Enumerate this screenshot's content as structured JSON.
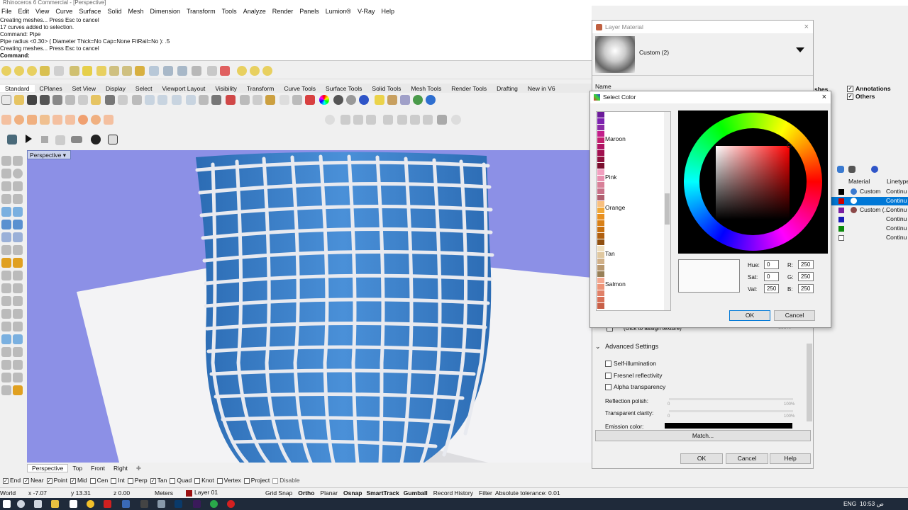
{
  "app": {
    "title": "Rhinoceros 6 Commercial - [Perspective]"
  },
  "menu": [
    "File",
    "Edit",
    "View",
    "Curve",
    "Surface",
    "Solid",
    "Mesh",
    "Dimension",
    "Transform",
    "Tools",
    "Analyze",
    "Render",
    "Panels",
    "Lumion®",
    "V-Ray",
    "Help"
  ],
  "command_history": [
    "Creating meshes... Press Esc to cancel",
    "17 curves added to selection.",
    "Command: Pipe",
    "Pipe radius <0.30> ( Diameter  Thick=No  Cap=None  FitRail=No ): .5",
    "Creating meshes... Press Esc to cancel",
    "Command:"
  ],
  "toolbar_tabs": [
    "Standard",
    "CPlanes",
    "Set View",
    "Display",
    "Select",
    "Viewport Layout",
    "Visibility",
    "Transform",
    "Curve Tools",
    "Surface Tools",
    "Solid Tools",
    "Mesh Tools",
    "Render Tools",
    "Drafting",
    "New in V6"
  ],
  "viewport": {
    "title": "Perspective",
    "tabs": [
      "Perspective",
      "Top",
      "Front",
      "Right"
    ]
  },
  "osnaps": [
    {
      "label": "End",
      "checked": true
    },
    {
      "label": "Near",
      "checked": true
    },
    {
      "label": "Point",
      "checked": true
    },
    {
      "label": "Mid",
      "checked": true
    },
    {
      "label": "Cen",
      "checked": false
    },
    {
      "label": "Int",
      "checked": false
    },
    {
      "label": "Perp",
      "checked": false
    },
    {
      "label": "Tan",
      "checked": true
    },
    {
      "label": "Quad",
      "checked": false
    },
    {
      "label": "Knot",
      "checked": false
    },
    {
      "label": "Vertex",
      "checked": false
    },
    {
      "label": "Project",
      "checked": false
    },
    {
      "label": "Disable",
      "checked": false
    }
  ],
  "status": {
    "cplane": "World",
    "x": "x -7.07",
    "y": "y 13.31",
    "z": "z 0.00",
    "units": "Meters",
    "layer": "Layer 01",
    "layer_color": "#9b1010",
    "toggles": [
      "Grid Snap",
      "Ortho",
      "Planar",
      "Osnap",
      "SmartTrack",
      "Gumball",
      "Record History",
      "Filter"
    ],
    "tolerance": "Absolute tolerance: 0.01"
  },
  "taskbar": {
    "lang": "ENG",
    "time": "10:53 ص"
  },
  "layer_material": {
    "title": "Layer Material",
    "material_name": "Custom (2)",
    "name_label": "Name",
    "texture_hint": "(click to assign texture)",
    "texture_amount": "100%",
    "advanced_title": "Advanced Settings",
    "options": [
      "Self-illumination",
      "Fresnel reflectivity",
      "Alpha transparency"
    ],
    "reflection_label": "Reflection polish:",
    "transparent_label": "Transparent clarity:",
    "emission_label": "Emission color:",
    "pct_0": "0",
    "pct_100": "100%",
    "match_label": "Match...",
    "ok": "OK",
    "cancel": "Cancel",
    "help": "Help"
  },
  "select_color": {
    "title": "Select Color",
    "named": [
      "Maroon",
      "Pink",
      "Orange",
      "Tan",
      "Salmon"
    ],
    "hue_label": "Hue:",
    "sat_label": "Sat:",
    "val_label": "Val:",
    "hue": "0",
    "sat": "0",
    "val": "250",
    "r_label": "R:",
    "g_label": "G:",
    "b_label": "B:",
    "r": "250",
    "g": "250",
    "b": "250",
    "ok": "OK",
    "cancel": "Cancel"
  },
  "layers_panel": {
    "partial_meshes": "shes",
    "checks": [
      {
        "label": "Annotations",
        "checked": true
      },
      {
        "label": "Others",
        "checked": true
      }
    ],
    "col_material": "Material",
    "col_linetype": "Linetype",
    "rows": [
      {
        "color": "#000000",
        "material": "Custom",
        "linetype": "Continu"
      },
      {
        "color": "#cc0000",
        "material": "",
        "linetype": "Continu",
        "selected": true
      },
      {
        "color": "#7a1fa2",
        "material": "Custom (...",
        "linetype": "Continu"
      },
      {
        "color": "#1a1ab8",
        "material": "",
        "linetype": "Continu"
      },
      {
        "color": "#0c8a0c",
        "material": "",
        "linetype": "Continu"
      },
      {
        "color": "#ffffff",
        "material": "",
        "linetype": "Continu"
      }
    ]
  }
}
